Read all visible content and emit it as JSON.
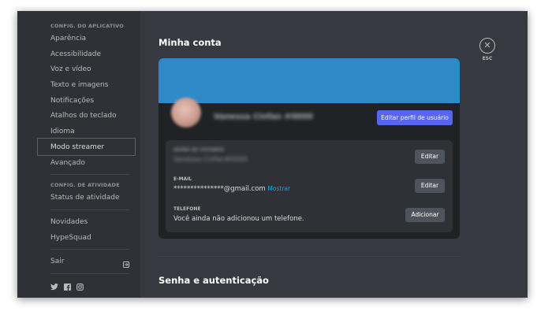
{
  "sidebar": {
    "app_settings_header": "CONFIG. DO APLICATIVO",
    "app_items": [
      {
        "label": "Aparência"
      },
      {
        "label": "Acessibilidade"
      },
      {
        "label": "Voz e vídeo"
      },
      {
        "label": "Texto e imagens"
      },
      {
        "label": "Notificações"
      },
      {
        "label": "Atalhos do teclado"
      },
      {
        "label": "Idioma"
      },
      {
        "label": "Modo streamer"
      },
      {
        "label": "Avançado"
      }
    ],
    "activity_header": "CONFIG. DE ATIVIDADE",
    "activity_items": [
      {
        "label": "Status de atividade"
      }
    ],
    "misc_items": [
      {
        "label": "Novidades"
      },
      {
        "label": "HypeSquad"
      }
    ],
    "logout_label": "Sair",
    "highlight_color": "#e3282b"
  },
  "main": {
    "title": "Minha conta",
    "close_label": "ESC",
    "profile": {
      "display_name": "Vanessa Cinfan #0000",
      "edit_profile_label": "Editar perfil de usuário",
      "banner_color": "#2f8ac8"
    },
    "fields": {
      "username": {
        "label": "NOME DE USUÁRIO",
        "value": "Vanessa Cinfan#0000",
        "button": "Editar"
      },
      "email": {
        "label": "E-MAIL",
        "value": "***************@gmail.com",
        "reveal": "Mostrar",
        "button": "Editar"
      },
      "phone": {
        "label": "TELEFONE",
        "value": "Você ainda não adicionou um telefone.",
        "button": "Adicionar"
      }
    },
    "security_title": "Senha e autenticação"
  },
  "colors": {
    "sidebar_bg": "#2f3136",
    "main_bg": "#36393f",
    "card_bg": "#202225",
    "accent": "#5865f2",
    "link": "#00aff4"
  }
}
